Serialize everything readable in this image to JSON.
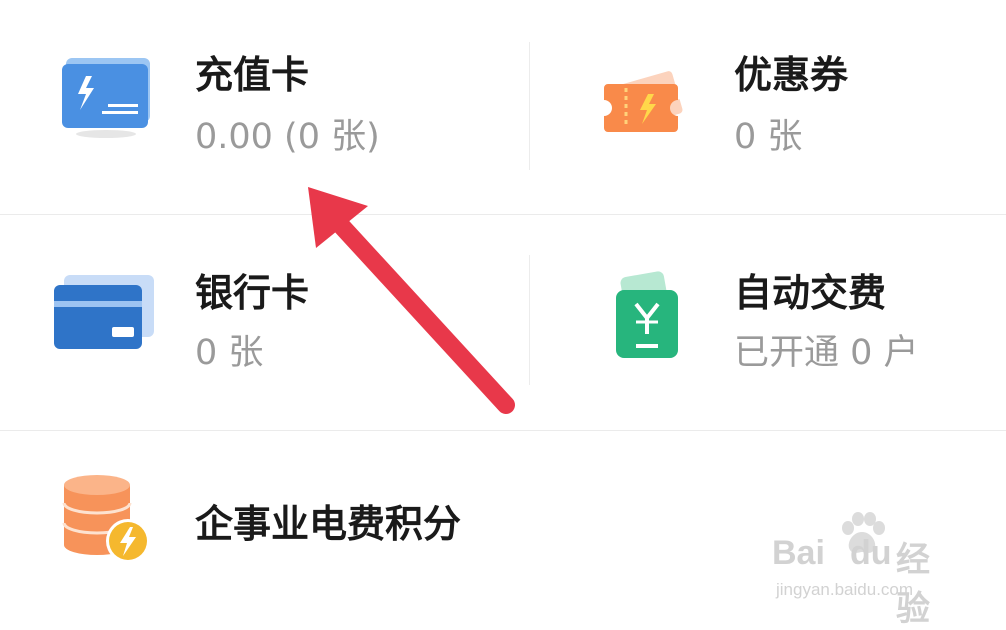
{
  "cards": [
    {
      "title": "充值卡",
      "subtitle": "0.00 (0 张)",
      "icon": "recharge-card-icon"
    },
    {
      "title": "优惠券",
      "subtitle": "0 张",
      "icon": "coupon-ticket-icon"
    },
    {
      "title": "银行卡",
      "subtitle": "0 张",
      "icon": "bank-card-icon"
    },
    {
      "title": "自动交费",
      "subtitle": "已开通 0 户",
      "icon": "auto-pay-icon"
    },
    {
      "title": "企事业电费积分",
      "icon": "coins-points-icon"
    }
  ],
  "watermark": {
    "brand": "Bai",
    "brand2": "du",
    "product": "经验",
    "url": "jingyan.baidu.com"
  },
  "colors": {
    "blue": "#4a90e2",
    "orange": "#f98a4a",
    "green": "#27b57d",
    "coin": "#f7935a",
    "arrow": "#e8384a"
  }
}
